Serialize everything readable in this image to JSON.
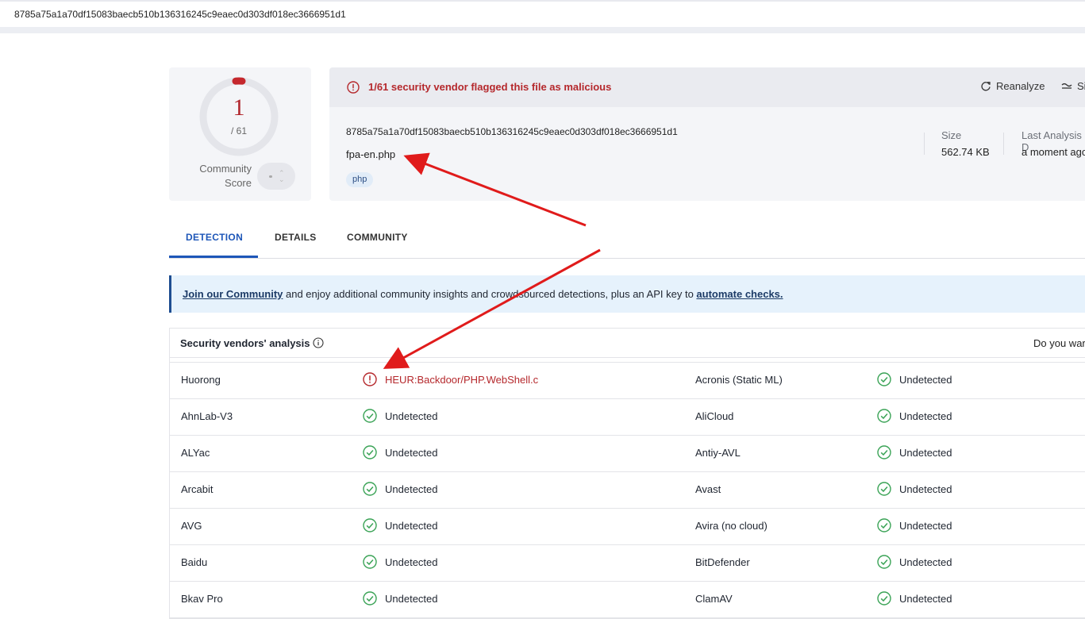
{
  "topbar": {
    "hash": "8785a75a1a70df15083baecb510b136316245c9eaec0d303df018ec3666951d1"
  },
  "score": {
    "value": "1",
    "total": "/ 61",
    "community_label": "Community Score"
  },
  "summary": {
    "alert": "1/61 security vendor flagged this file as malicious",
    "reanalyze_label": "Reanalyze",
    "similar_label": "Si",
    "file_hash": "8785a75a1a70df15083baecb510b136316245c9eaec0d303df018ec3666951d1",
    "file_name": "fpa-en.php",
    "tag": "php",
    "size_label": "Size",
    "size_value": "562.74 KB",
    "last_analysis_label": "Last Analysis D",
    "last_analysis_value": "a moment ago"
  },
  "tabs": [
    "DETECTION",
    "DETAILS",
    "COMMUNITY"
  ],
  "banner": {
    "link1": "Join our Community",
    "middle": " and enjoy additional community insights and crowdsourced detections, plus an API key to ",
    "link2": "automate checks."
  },
  "vendors": {
    "title": "Security vendors' analysis",
    "cta": "Do you war",
    "rows": [
      {
        "left_name": "Huorong",
        "left_result": "HEUR:Backdoor/PHP.WebShell.c",
        "left_status": "malicious",
        "right_name": "Acronis (Static ML)",
        "right_result": "Undetected",
        "right_status": "clean"
      },
      {
        "left_name": "AhnLab-V3",
        "left_result": "Undetected",
        "left_status": "clean",
        "right_name": "AliCloud",
        "right_result": "Undetected",
        "right_status": "clean"
      },
      {
        "left_name": "ALYac",
        "left_result": "Undetected",
        "left_status": "clean",
        "right_name": "Antiy-AVL",
        "right_result": "Undetected",
        "right_status": "clean"
      },
      {
        "left_name": "Arcabit",
        "left_result": "Undetected",
        "left_status": "clean",
        "right_name": "Avast",
        "right_result": "Undetected",
        "right_status": "clean"
      },
      {
        "left_name": "AVG",
        "left_result": "Undetected",
        "left_status": "clean",
        "right_name": "Avira (no cloud)",
        "right_result": "Undetected",
        "right_status": "clean"
      },
      {
        "left_name": "Baidu",
        "left_result": "Undetected",
        "left_status": "clean",
        "right_name": "BitDefender",
        "right_result": "Undetected",
        "right_status": "clean"
      },
      {
        "left_name": "Bkav Pro",
        "left_result": "Undetected",
        "left_status": "clean",
        "right_name": "ClamAV",
        "right_result": "Undetected",
        "right_status": "clean"
      }
    ]
  },
  "colors": {
    "malicious": "#b5282c",
    "clean": "#3aa356",
    "accent": "#1d56b8",
    "arrow": "#e01b1b"
  }
}
